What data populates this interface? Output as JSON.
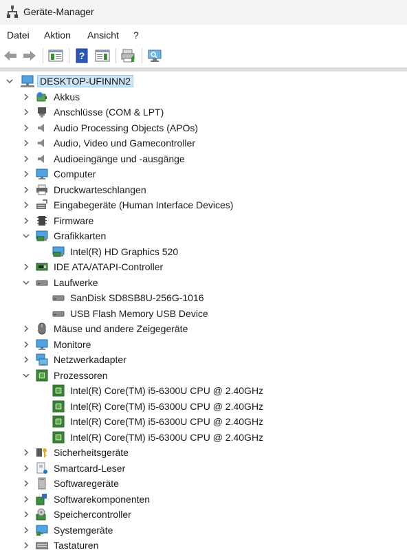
{
  "window": {
    "title": "Geräte-Manager"
  },
  "menu": [
    "Datei",
    "Aktion",
    "Ansicht",
    "?"
  ],
  "tree": {
    "root": "DESKTOP-UFINNN2",
    "items": [
      {
        "label": "Akkus",
        "icon": "battery-icon",
        "expanded": false
      },
      {
        "label": "Anschlüsse (COM & LPT)",
        "icon": "port-icon",
        "expanded": false
      },
      {
        "label": "Audio Processing Objects (APOs)",
        "icon": "speaker-icon",
        "expanded": false
      },
      {
        "label": "Audio, Video und Gamecontroller",
        "icon": "speaker-icon",
        "expanded": false
      },
      {
        "label": "Audioeingänge und -ausgänge",
        "icon": "speaker-icon",
        "expanded": false
      },
      {
        "label": "Computer",
        "icon": "monitor-icon",
        "expanded": false
      },
      {
        "label": "Druckwarteschlangen",
        "icon": "printer-icon",
        "expanded": false
      },
      {
        "label": "Eingabegeräte (Human Interface Devices)",
        "icon": "hid-icon",
        "expanded": false
      },
      {
        "label": "Firmware",
        "icon": "firmware-icon",
        "expanded": false
      },
      {
        "label": "Grafikkarten",
        "icon": "display-adapter-icon",
        "expanded": true,
        "children": [
          {
            "label": "Intel(R) HD Graphics 520",
            "icon": "display-adapter-icon"
          }
        ]
      },
      {
        "label": "IDE ATA/ATAPI-Controller",
        "icon": "ide-icon",
        "expanded": false
      },
      {
        "label": "Laufwerke",
        "icon": "drive-icon",
        "expanded": true,
        "children": [
          {
            "label": "SanDisk SD8SB8U-256G-1016",
            "icon": "drive-icon"
          },
          {
            "label": "USB Flash Memory USB Device",
            "icon": "drive-icon"
          }
        ]
      },
      {
        "label": "Mäuse und andere Zeigegeräte",
        "icon": "mouse-icon",
        "expanded": false
      },
      {
        "label": "Monitore",
        "icon": "monitor-icon",
        "expanded": false
      },
      {
        "label": "Netzwerkadapter",
        "icon": "network-icon",
        "expanded": false
      },
      {
        "label": "Prozessoren",
        "icon": "cpu-icon",
        "expanded": true,
        "children": [
          {
            "label": "Intel(R) Core(TM) i5-6300U CPU @ 2.40GHz",
            "icon": "cpu-icon"
          },
          {
            "label": "Intel(R) Core(TM) i5-6300U CPU @ 2.40GHz",
            "icon": "cpu-icon"
          },
          {
            "label": "Intel(R) Core(TM) i5-6300U CPU @ 2.40GHz",
            "icon": "cpu-icon"
          },
          {
            "label": "Intel(R) Core(TM) i5-6300U CPU @ 2.40GHz",
            "icon": "cpu-icon"
          }
        ]
      },
      {
        "label": "Sicherheitsgeräte",
        "icon": "security-icon",
        "expanded": false
      },
      {
        "label": "Smartcard-Leser",
        "icon": "smartcard-icon",
        "expanded": false
      },
      {
        "label": "Softwaregeräte",
        "icon": "software-device-icon",
        "expanded": false
      },
      {
        "label": "Softwarekomponenten",
        "icon": "software-component-icon",
        "expanded": false
      },
      {
        "label": "Speichercontroller",
        "icon": "storage-controller-icon",
        "expanded": false
      },
      {
        "label": "Systemgeräte",
        "icon": "system-icon",
        "expanded": false
      },
      {
        "label": "Tastaturen",
        "icon": "keyboard-icon",
        "expanded": false
      }
    ]
  }
}
